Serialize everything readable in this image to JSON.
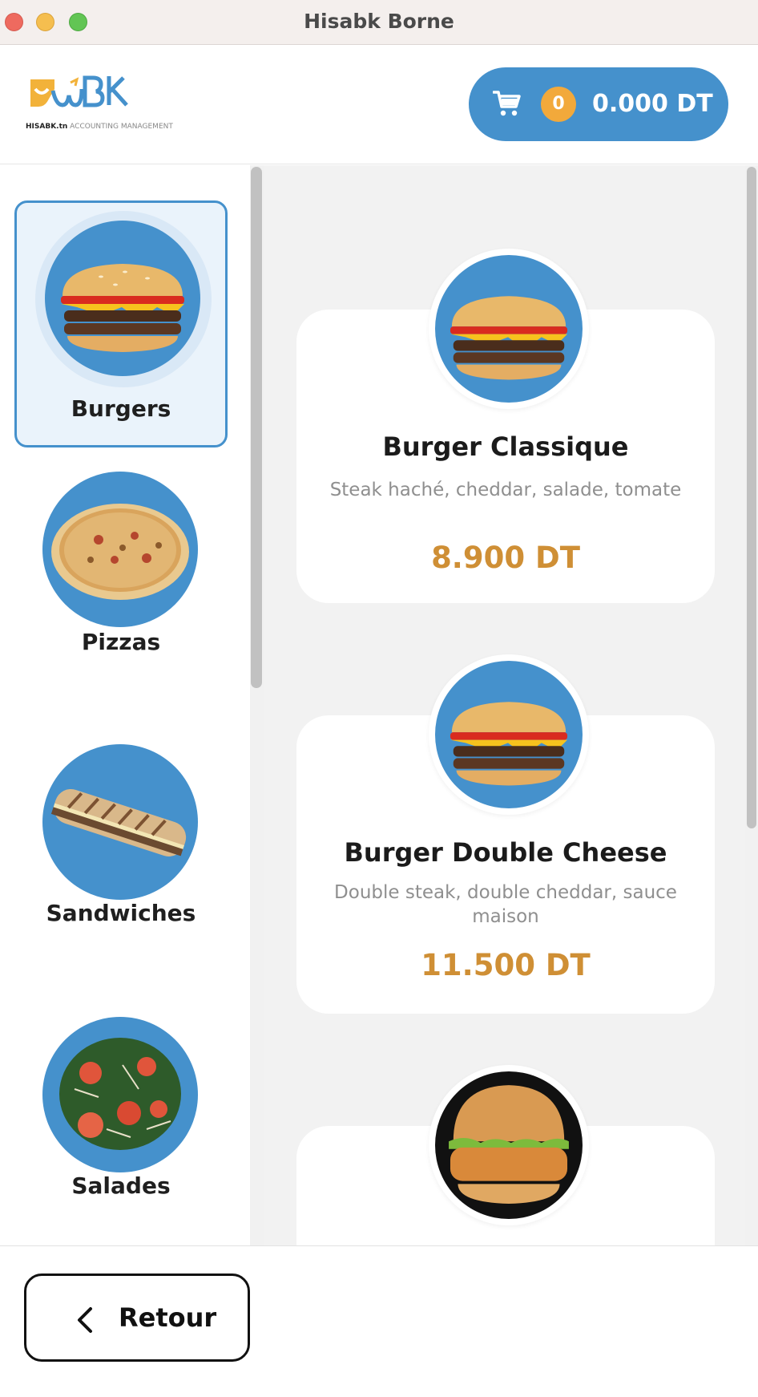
{
  "window": {
    "title": "Hisabk Borne"
  },
  "header": {
    "logo_text": "HISABK.tn",
    "logo_subtitle": "ACCOUNTING MANAGEMENT",
    "cart": {
      "count": "0",
      "total": "0.000 DT"
    }
  },
  "categories": [
    {
      "label": "Burgers",
      "active": true,
      "icon": "burger"
    },
    {
      "label": "Pizzas",
      "active": false,
      "icon": "pizza"
    },
    {
      "label": "Sandwiches",
      "active": false,
      "icon": "panini"
    },
    {
      "label": "Salades",
      "active": false,
      "icon": "salad"
    }
  ],
  "products": [
    {
      "name": "Burger Classique",
      "description": "Steak haché, cheddar, salade, tomate",
      "price": "8.900 DT",
      "icon": "burger"
    },
    {
      "name": "Burger Double Cheese",
      "description": "Double steak, double cheddar, sauce maison",
      "price": "11.500 DT",
      "icon": "burger"
    },
    {
      "icon": "chicken-burger"
    }
  ],
  "footer": {
    "back_label": "Retour"
  },
  "colors": {
    "primary": "#4591cc",
    "accent": "#f2a93b",
    "price": "#cf8f35"
  }
}
